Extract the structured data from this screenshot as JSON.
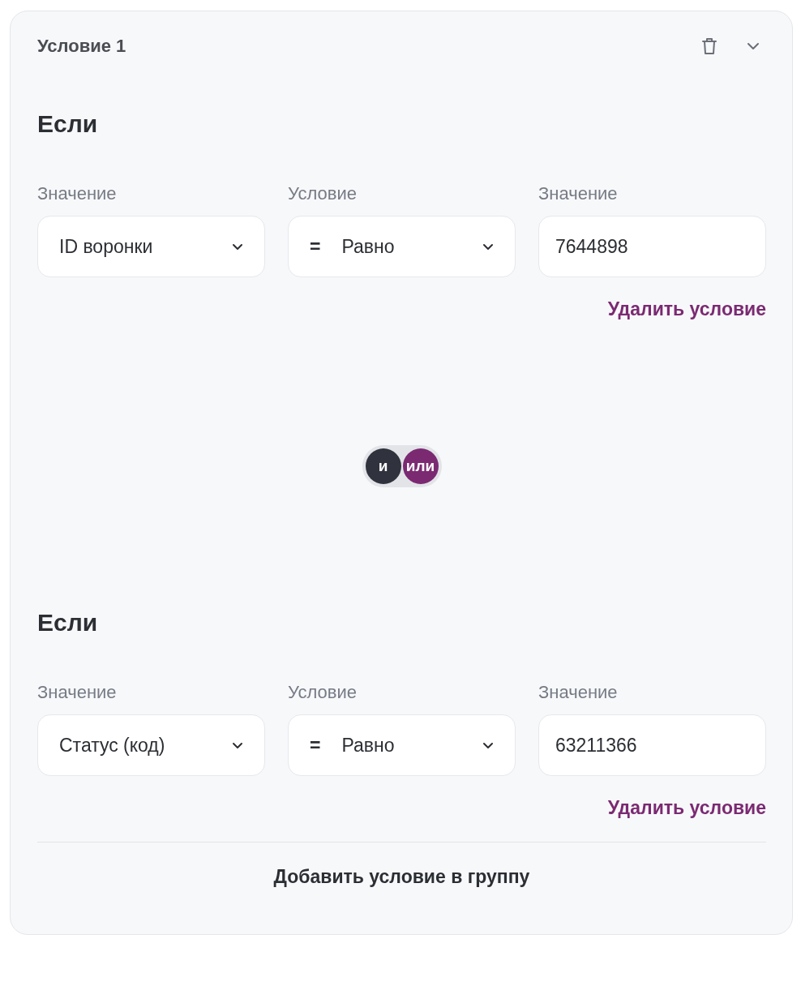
{
  "card": {
    "title": "Условие 1"
  },
  "conditions": [
    {
      "heading": "Если",
      "fields": [
        {
          "label": "Значение",
          "kind": "select",
          "value": "ID воронки"
        },
        {
          "label": "Условие",
          "kind": "select",
          "operator": "=",
          "value": "Равно"
        },
        {
          "label": "Значение",
          "kind": "input",
          "value": "7644898"
        }
      ],
      "remove_link": "Удалить условие"
    },
    {
      "heading": "Если",
      "fields": [
        {
          "label": "Значение",
          "kind": "select",
          "value": "Статус (код)"
        },
        {
          "label": "Условие",
          "kind": "select",
          "operator": "=",
          "value": "Равно"
        },
        {
          "label": "Значение",
          "kind": "input",
          "value": "63211366"
        }
      ],
      "remove_link": "Удалить условие"
    }
  ],
  "logic_toggle": [
    {
      "label": "и",
      "color": "#30323d"
    },
    {
      "label": "или",
      "color": "#7b2a72"
    }
  ],
  "add_button": "Добавить условие в группу"
}
